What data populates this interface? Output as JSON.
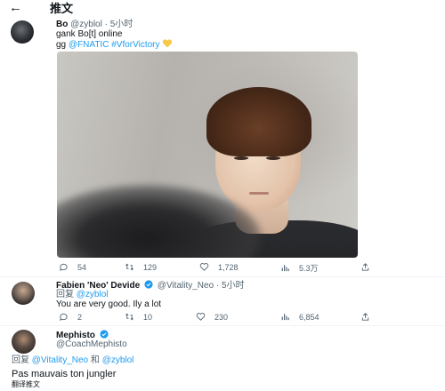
{
  "topbar": {
    "back_icon": "back-arrow-icon",
    "title": "推文"
  },
  "tweet": {
    "author_name": "Bo",
    "handle": "@zyblol",
    "sep": "·",
    "time": "5小时",
    "text_line1": "gank Bo[t] online",
    "text_line2_prefix": "gg ",
    "text_line2_mention": "@FNATIC",
    "text_line2_hashtag": "#VforVictory",
    "emoji_icon": "yellow-heart-icon",
    "reply_count": "54",
    "retweet_count": "129",
    "like_count": "1,728",
    "views_count": "5.3万"
  },
  "reply1": {
    "author_name": "Fabien 'Neo' Devide",
    "handle": "@Vitality_Neo",
    "sep": "·",
    "time": "5小时",
    "replying_prefix": "回复 ",
    "replying_to": "@zyblol",
    "text": "You are very good. Ily a lot",
    "reply_count": "2",
    "retweet_count": "10",
    "like_count": "230",
    "views_count": "6,854"
  },
  "reply2": {
    "author_name": "Mephisto",
    "handle": "@CoachMephisto",
    "replying_prefix": "回复 ",
    "replying_to_1": "@Vitality_Neo",
    "replying_and": " 和 ",
    "replying_to_2": "@zyblol",
    "text": "Pas mauvais ton jungler",
    "translate": "翻译推文"
  },
  "colors": {
    "accent": "#1d9bf0",
    "muted": "#536471",
    "text": "#0f1419"
  }
}
